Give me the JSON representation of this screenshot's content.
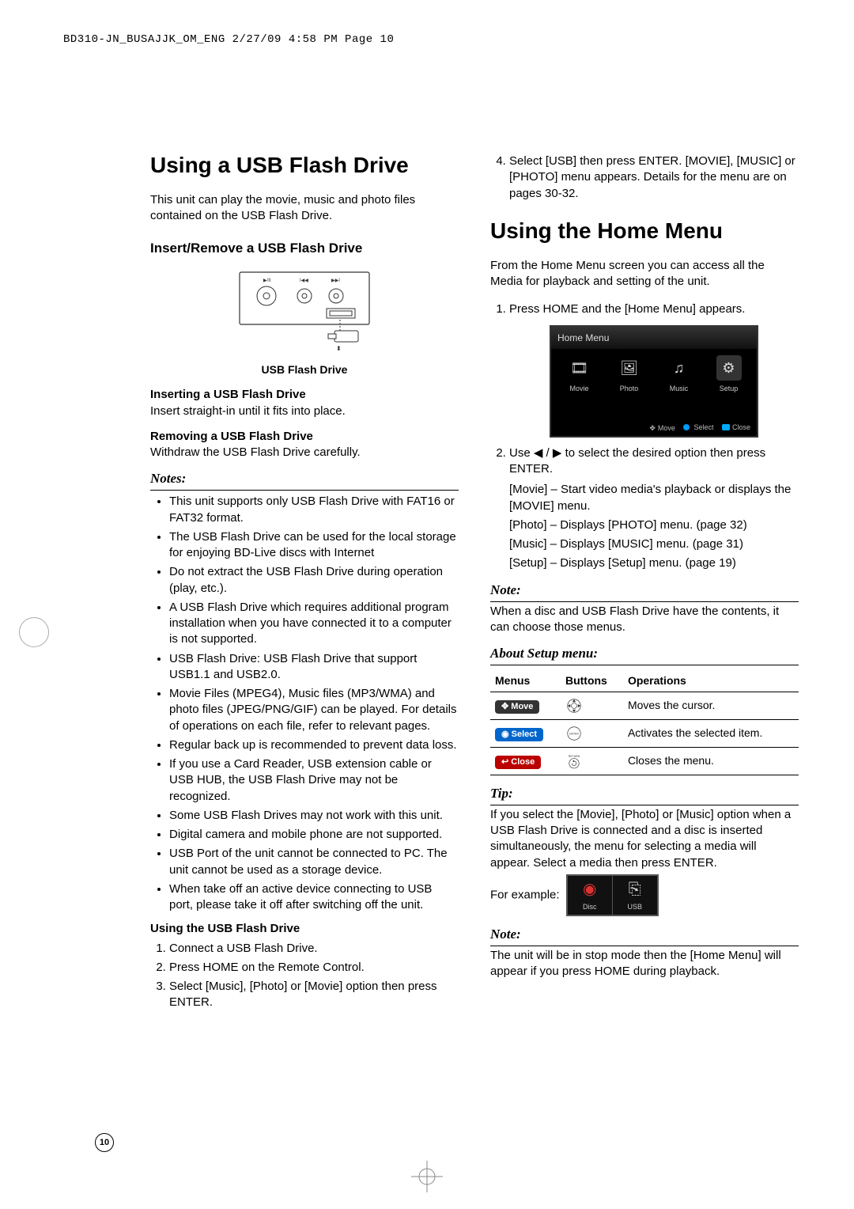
{
  "header_line": "BD310-JN_BUSAJJK_OM_ENG  2/27/09  4:58 PM  Page 10",
  "page_number": "10",
  "left": {
    "h1": "Using a USB Flash Drive",
    "intro": "This unit can play the movie, music and photo files contained on the USB Flash Drive.",
    "sub_insert": "Insert/Remove a USB Flash Drive",
    "fig_caption": "USB Flash Drive",
    "inserting_h": "Inserting a USB Flash Drive",
    "inserting_p": "Insert straight-in until it fits into place.",
    "removing_h": "Removing a USB Flash Drive",
    "removing_p": "Withdraw the USB Flash Drive carefully.",
    "notes_h": "Notes:",
    "notes": [
      "This unit supports only USB Flash Drive with FAT16 or FAT32 format.",
      "The USB Flash Drive can be used for the local storage for enjoying BD-Live discs with Internet",
      "Do not extract the USB Flash Drive during operation (play, etc.).",
      "A USB Flash Drive which requires additional program installation when you have connected it to a computer is not supported.",
      "USB Flash Drive: USB Flash Drive that support USB1.1 and USB2.0.",
      "Movie Files (MPEG4), Music files (MP3/WMA) and photo files (JPEG/PNG/GIF) can be played. For details of operations on each file, refer to relevant pages.",
      "Regular back up is recommended to prevent data loss.",
      "If you use a Card Reader, USB extension cable or USB HUB, the USB Flash Drive may not be recognized.",
      "Some USB Flash Drives may not work with this unit.",
      "Digital camera and mobile phone are not supported.",
      "USB Port of the unit cannot be connected to PC. The unit cannot be used as a storage device.",
      "When take off an active device connecting to USB port, please take it off after switching off the unit."
    ],
    "using_h": "Using the USB Flash Drive",
    "using_steps": [
      "Connect a USB Flash Drive.",
      "Press HOME on the Remote Control.",
      "Select [Music], [Photo] or [Movie] option then press ENTER."
    ]
  },
  "right": {
    "step4": "Select [USB] then press ENTER. [MOVIE], [MUSIC] or [PHOTO] menu appears. Details for the menu are on pages 30-32.",
    "h1": "Using the Home Menu",
    "intro": "From the Home Menu screen you can access all the Media for playback and setting of the unit.",
    "step1": "Press HOME and the [Home Menu] appears.",
    "home_menu": {
      "title": "Home Menu",
      "items": [
        {
          "label": "Movie",
          "icon": "🎞"
        },
        {
          "label": "Photo",
          "icon": "🖼"
        },
        {
          "label": "Music",
          "icon": "♫"
        },
        {
          "label": "Setup",
          "icon": "⚙"
        }
      ],
      "hints": {
        "move": "Move",
        "select": "Select",
        "close": "Close"
      }
    },
    "step2_a": "Use ◀ / ▶ to select the desired option then press ENTER.",
    "step2_b": [
      "[Movie] – Start video media's playback or displays the [MOVIE] menu.",
      "[Photo] – Displays [PHOTO] menu. (page 32)",
      "[Music] – Displays [MUSIC] menu. (page 31)",
      "[Setup] – Displays [Setup] menu. (page 19)"
    ],
    "note1_h": "Note:",
    "note1": "When a disc and USB Flash Drive have the contents, it can choose those menus.",
    "about_h": "About Setup menu:",
    "table": {
      "headers": [
        "Menus",
        "Buttons",
        "Operations"
      ],
      "rows": [
        {
          "menu": "Move",
          "menu_class": "badge",
          "op": "Moves the cursor."
        },
        {
          "menu": "Select",
          "menu_class": "badge blue",
          "op": "Activates the selected item."
        },
        {
          "menu": "Close",
          "menu_class": "badge red",
          "op": "Closes the menu."
        }
      ],
      "btn_labels": {
        "enter": "ENTER",
        "return": "RETURN"
      }
    },
    "tip_h": "Tip:",
    "tip": "If you select the [Movie], [Photo] or [Music] option when a USB Flash Drive is connected and a disc is inserted simultaneously, the menu for selecting a media will appear. Select a media then press ENTER.",
    "tip_example": "For example:",
    "disc_usb": {
      "a": "Disc",
      "b": "USB"
    },
    "note2_h": "Note:",
    "note2": "The unit will be in stop mode then the [Home Menu] will appear if you press HOME during playback."
  }
}
